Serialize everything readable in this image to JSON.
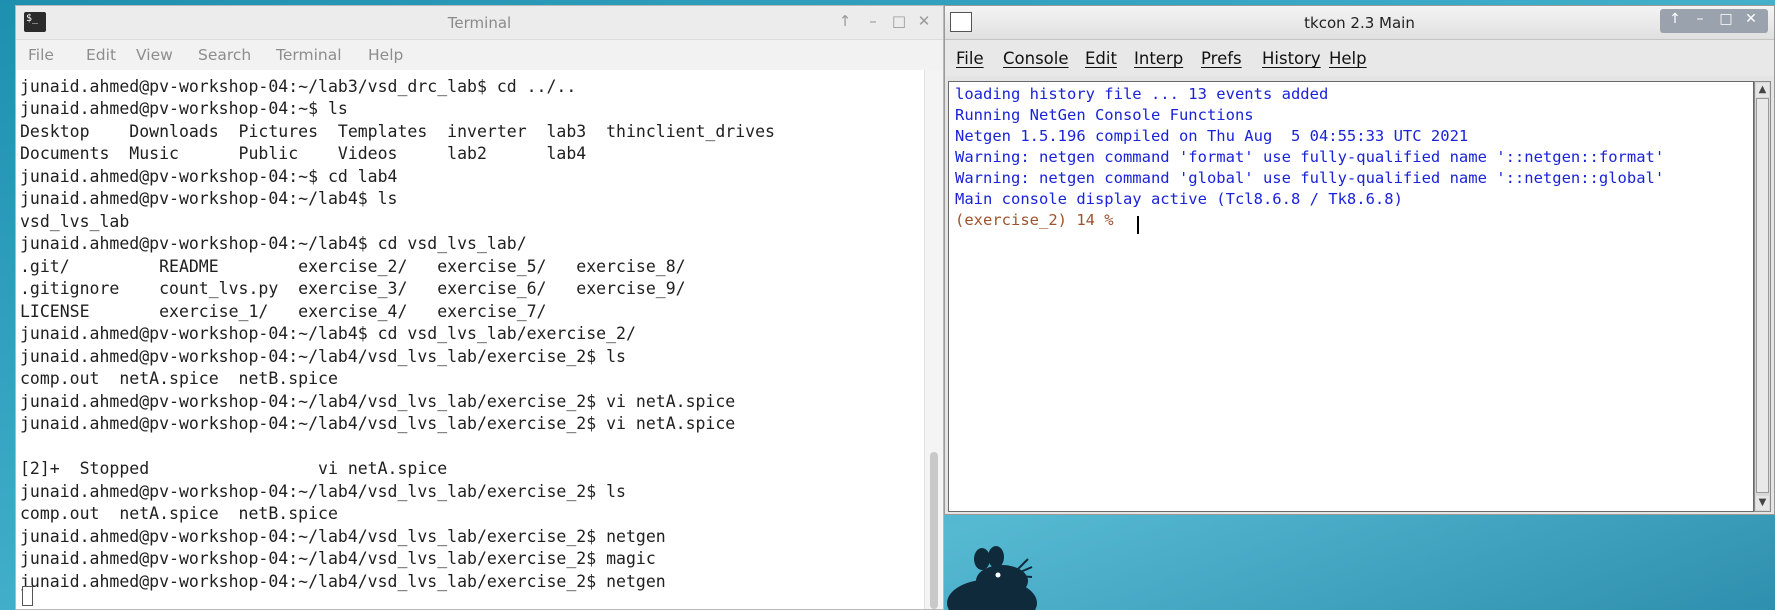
{
  "terminal": {
    "title": "Terminal",
    "icon": "terminal-icon",
    "menu": [
      "File",
      "Edit",
      "View",
      "Search",
      "Terminal",
      "Help"
    ],
    "lines": [
      "junaid.ahmed@pv-workshop-04:~/lab3/vsd_drc_lab$ cd ../..",
      "junaid.ahmed@pv-workshop-04:~$ ls",
      "Desktop    Downloads  Pictures  Templates  inverter  lab3  thinclient_drives",
      "Documents  Music      Public    Videos     lab2      lab4",
      "junaid.ahmed@pv-workshop-04:~$ cd lab4",
      "junaid.ahmed@pv-workshop-04:~/lab4$ ls",
      "vsd_lvs_lab",
      "junaid.ahmed@pv-workshop-04:~/lab4$ cd vsd_lvs_lab/",
      ".git/         README        exercise_2/   exercise_5/   exercise_8/",
      ".gitignore    count_lvs.py  exercise_3/   exercise_6/   exercise_9/",
      "LICENSE       exercise_1/   exercise_4/   exercise_7/",
      "junaid.ahmed@pv-workshop-04:~/lab4$ cd vsd_lvs_lab/exercise_2/",
      "junaid.ahmed@pv-workshop-04:~/lab4/vsd_lvs_lab/exercise_2$ ls",
      "comp.out  netA.spice  netB.spice",
      "junaid.ahmed@pv-workshop-04:~/lab4/vsd_lvs_lab/exercise_2$ vi netA.spice",
      "junaid.ahmed@pv-workshop-04:~/lab4/vsd_lvs_lab/exercise_2$ vi netA.spice",
      "",
      "[2]+  Stopped                 vi netA.spice",
      "junaid.ahmed@pv-workshop-04:~/lab4/vsd_lvs_lab/exercise_2$ ls",
      "comp.out  netA.spice  netB.spice",
      "junaid.ahmed@pv-workshop-04:~/lab4/vsd_lvs_lab/exercise_2$ netgen",
      "junaid.ahmed@pv-workshop-04:~/lab4/vsd_lvs_lab/exercise_2$ magic",
      "junaid.ahmed@pv-workshop-04:~/lab4/vsd_lvs_lab/exercise_2$ netgen"
    ]
  },
  "tkcon": {
    "title": "tkcon 2.3 Main",
    "menu": [
      "File",
      "Console",
      "Edit",
      "Interp",
      "Prefs",
      "History",
      "Help"
    ],
    "lines": [
      "loading history file ... 13 events added",
      "Running NetGen Console Functions",
      "Netgen 1.5.196 compiled on Thu Aug  5 04:55:33 UTC 2021",
      "Warning: netgen command 'format' use fully-qualified name '::netgen::format'",
      "Warning: netgen command 'global' use fully-qualified name '::netgen::global'",
      "Main console display active (Tcl8.6.8 / Tk8.6.8)"
    ],
    "prompt": "(exercise_2) 14 % ",
    "colors": {
      "output": "#1a23d8",
      "prompt": "#a0522d"
    }
  }
}
